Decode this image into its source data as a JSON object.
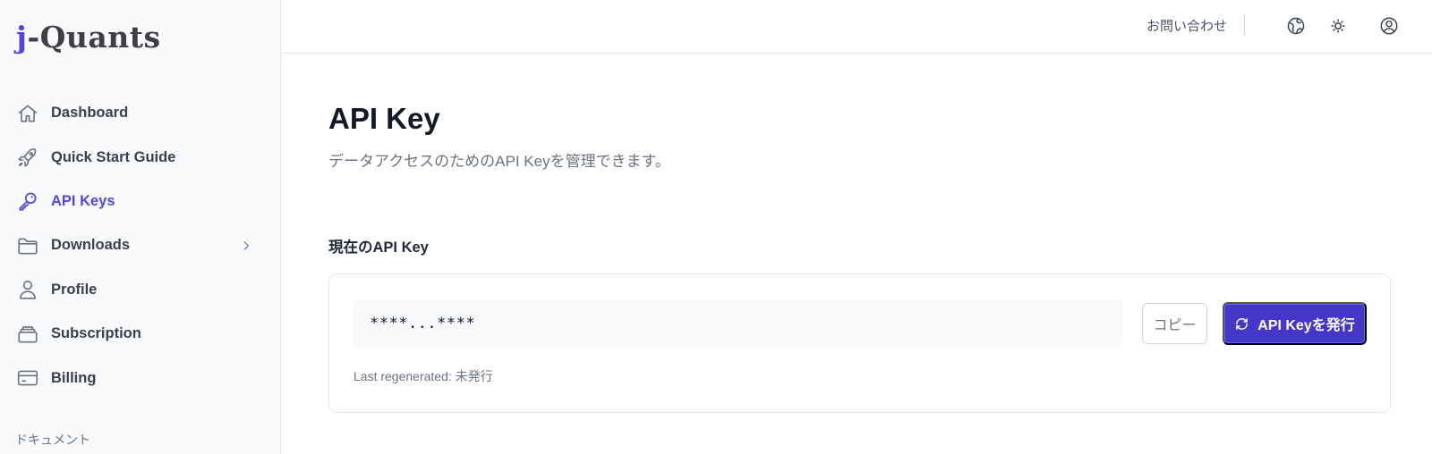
{
  "logo": {
    "first": "j",
    "rest": "-Quants"
  },
  "sidebar": {
    "items": [
      {
        "label": "Dashboard",
        "icon": "home-icon",
        "active": false
      },
      {
        "label": "Quick Start Guide",
        "icon": "rocket-icon",
        "active": false
      },
      {
        "label": "API Keys",
        "icon": "key-icon",
        "active": true
      },
      {
        "label": "Downloads",
        "icon": "folder-icon",
        "active": false,
        "expandable": true
      },
      {
        "label": "Profile",
        "icon": "user-icon",
        "active": false
      },
      {
        "label": "Subscription",
        "icon": "stack-icon",
        "active": false
      },
      {
        "label": "Billing",
        "icon": "credit-card-icon",
        "active": false
      }
    ],
    "section_label": "ドキュメント"
  },
  "header": {
    "contact": "お問い合わせ",
    "icons": [
      "globe-icon",
      "sun-icon",
      "user-circle-icon"
    ]
  },
  "main": {
    "title": "API Key",
    "subtitle": "データアクセスのためのAPI Keyを管理できます。",
    "section_title": "現在のAPI Key",
    "api_key_value": "****...****",
    "copy_label": "コピー",
    "issue_label": "API Keyを発行",
    "last_regenerated": "Last regenerated: 未発行"
  },
  "colors": {
    "accent": "#4f46e5",
    "button": "#4338ca",
    "sidebar_bg": "#f9fafb"
  }
}
